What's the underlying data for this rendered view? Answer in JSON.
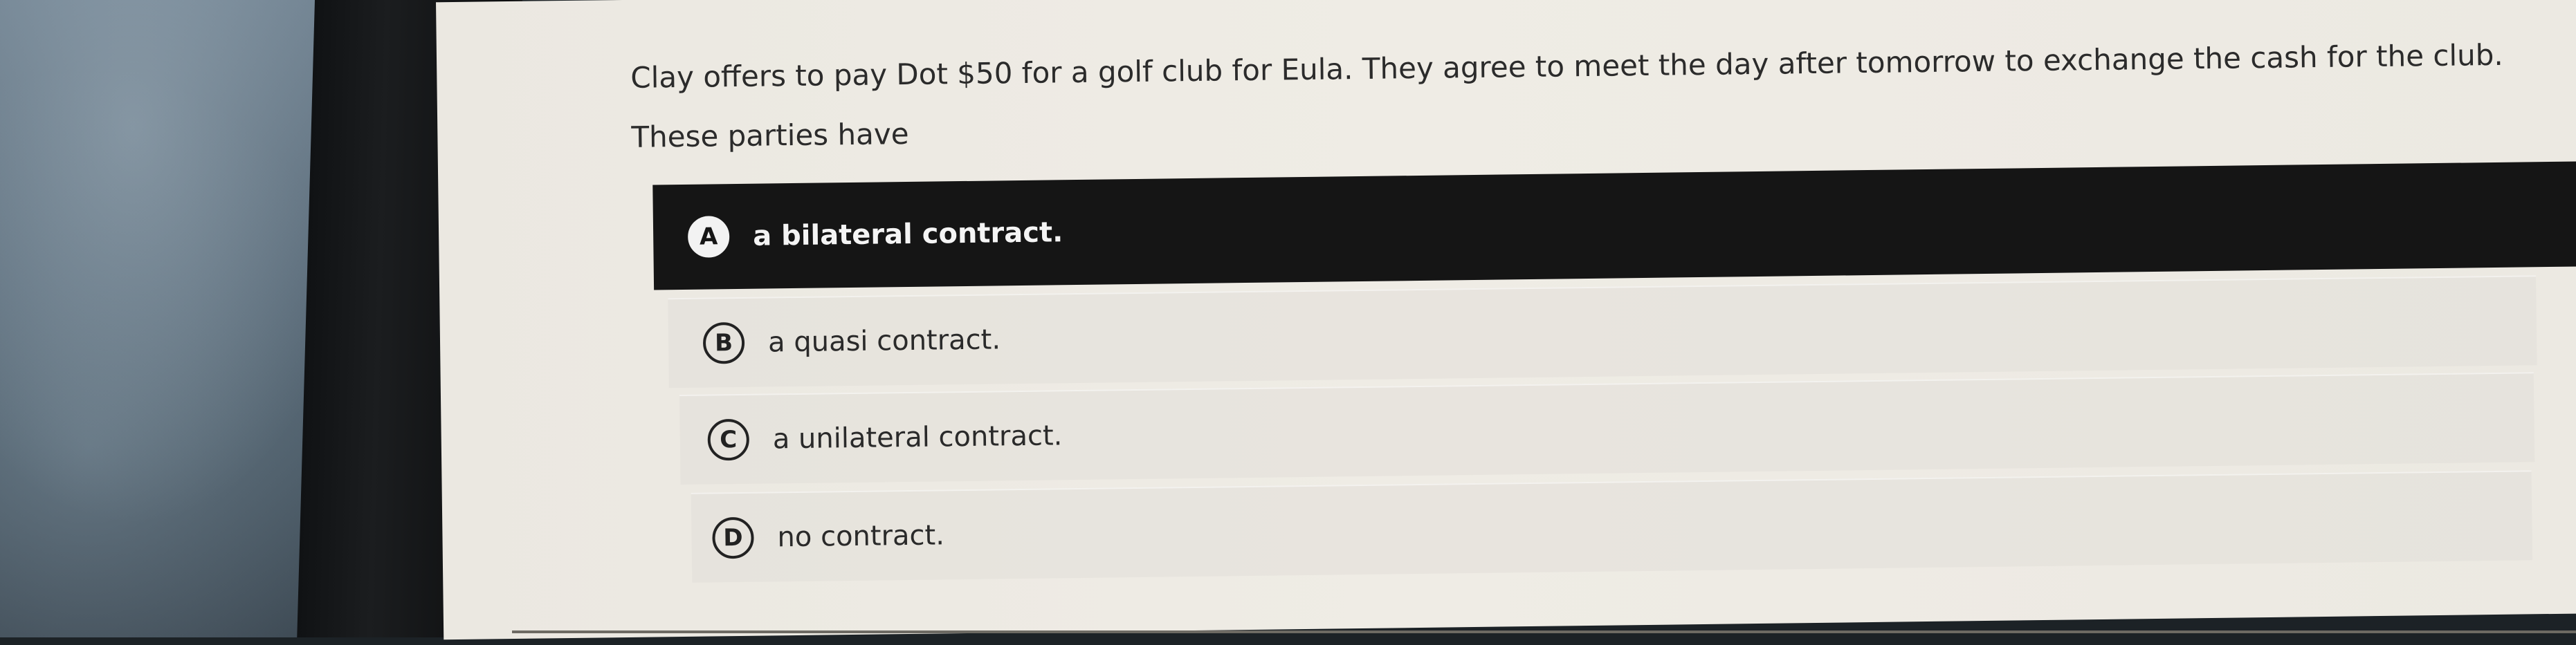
{
  "question": {
    "line1": "Clay offers to pay Dot $50 for a golf club for Eula. They agree to meet the day after tomorrow to exchange the cash for the club.",
    "line2": "These parties have"
  },
  "options": [
    {
      "letter": "A",
      "text": "a bilateral contract.",
      "selected": true
    },
    {
      "letter": "B",
      "text": "a quasi contract.",
      "selected": false
    },
    {
      "letter": "C",
      "text": "a unilateral contract.",
      "selected": false
    },
    {
      "letter": "D",
      "text": "no contract.",
      "selected": false
    }
  ],
  "colors": {
    "selected_bg": "#151515",
    "screen_bg": "#ebe8e1",
    "text": "#2b2b2b"
  }
}
